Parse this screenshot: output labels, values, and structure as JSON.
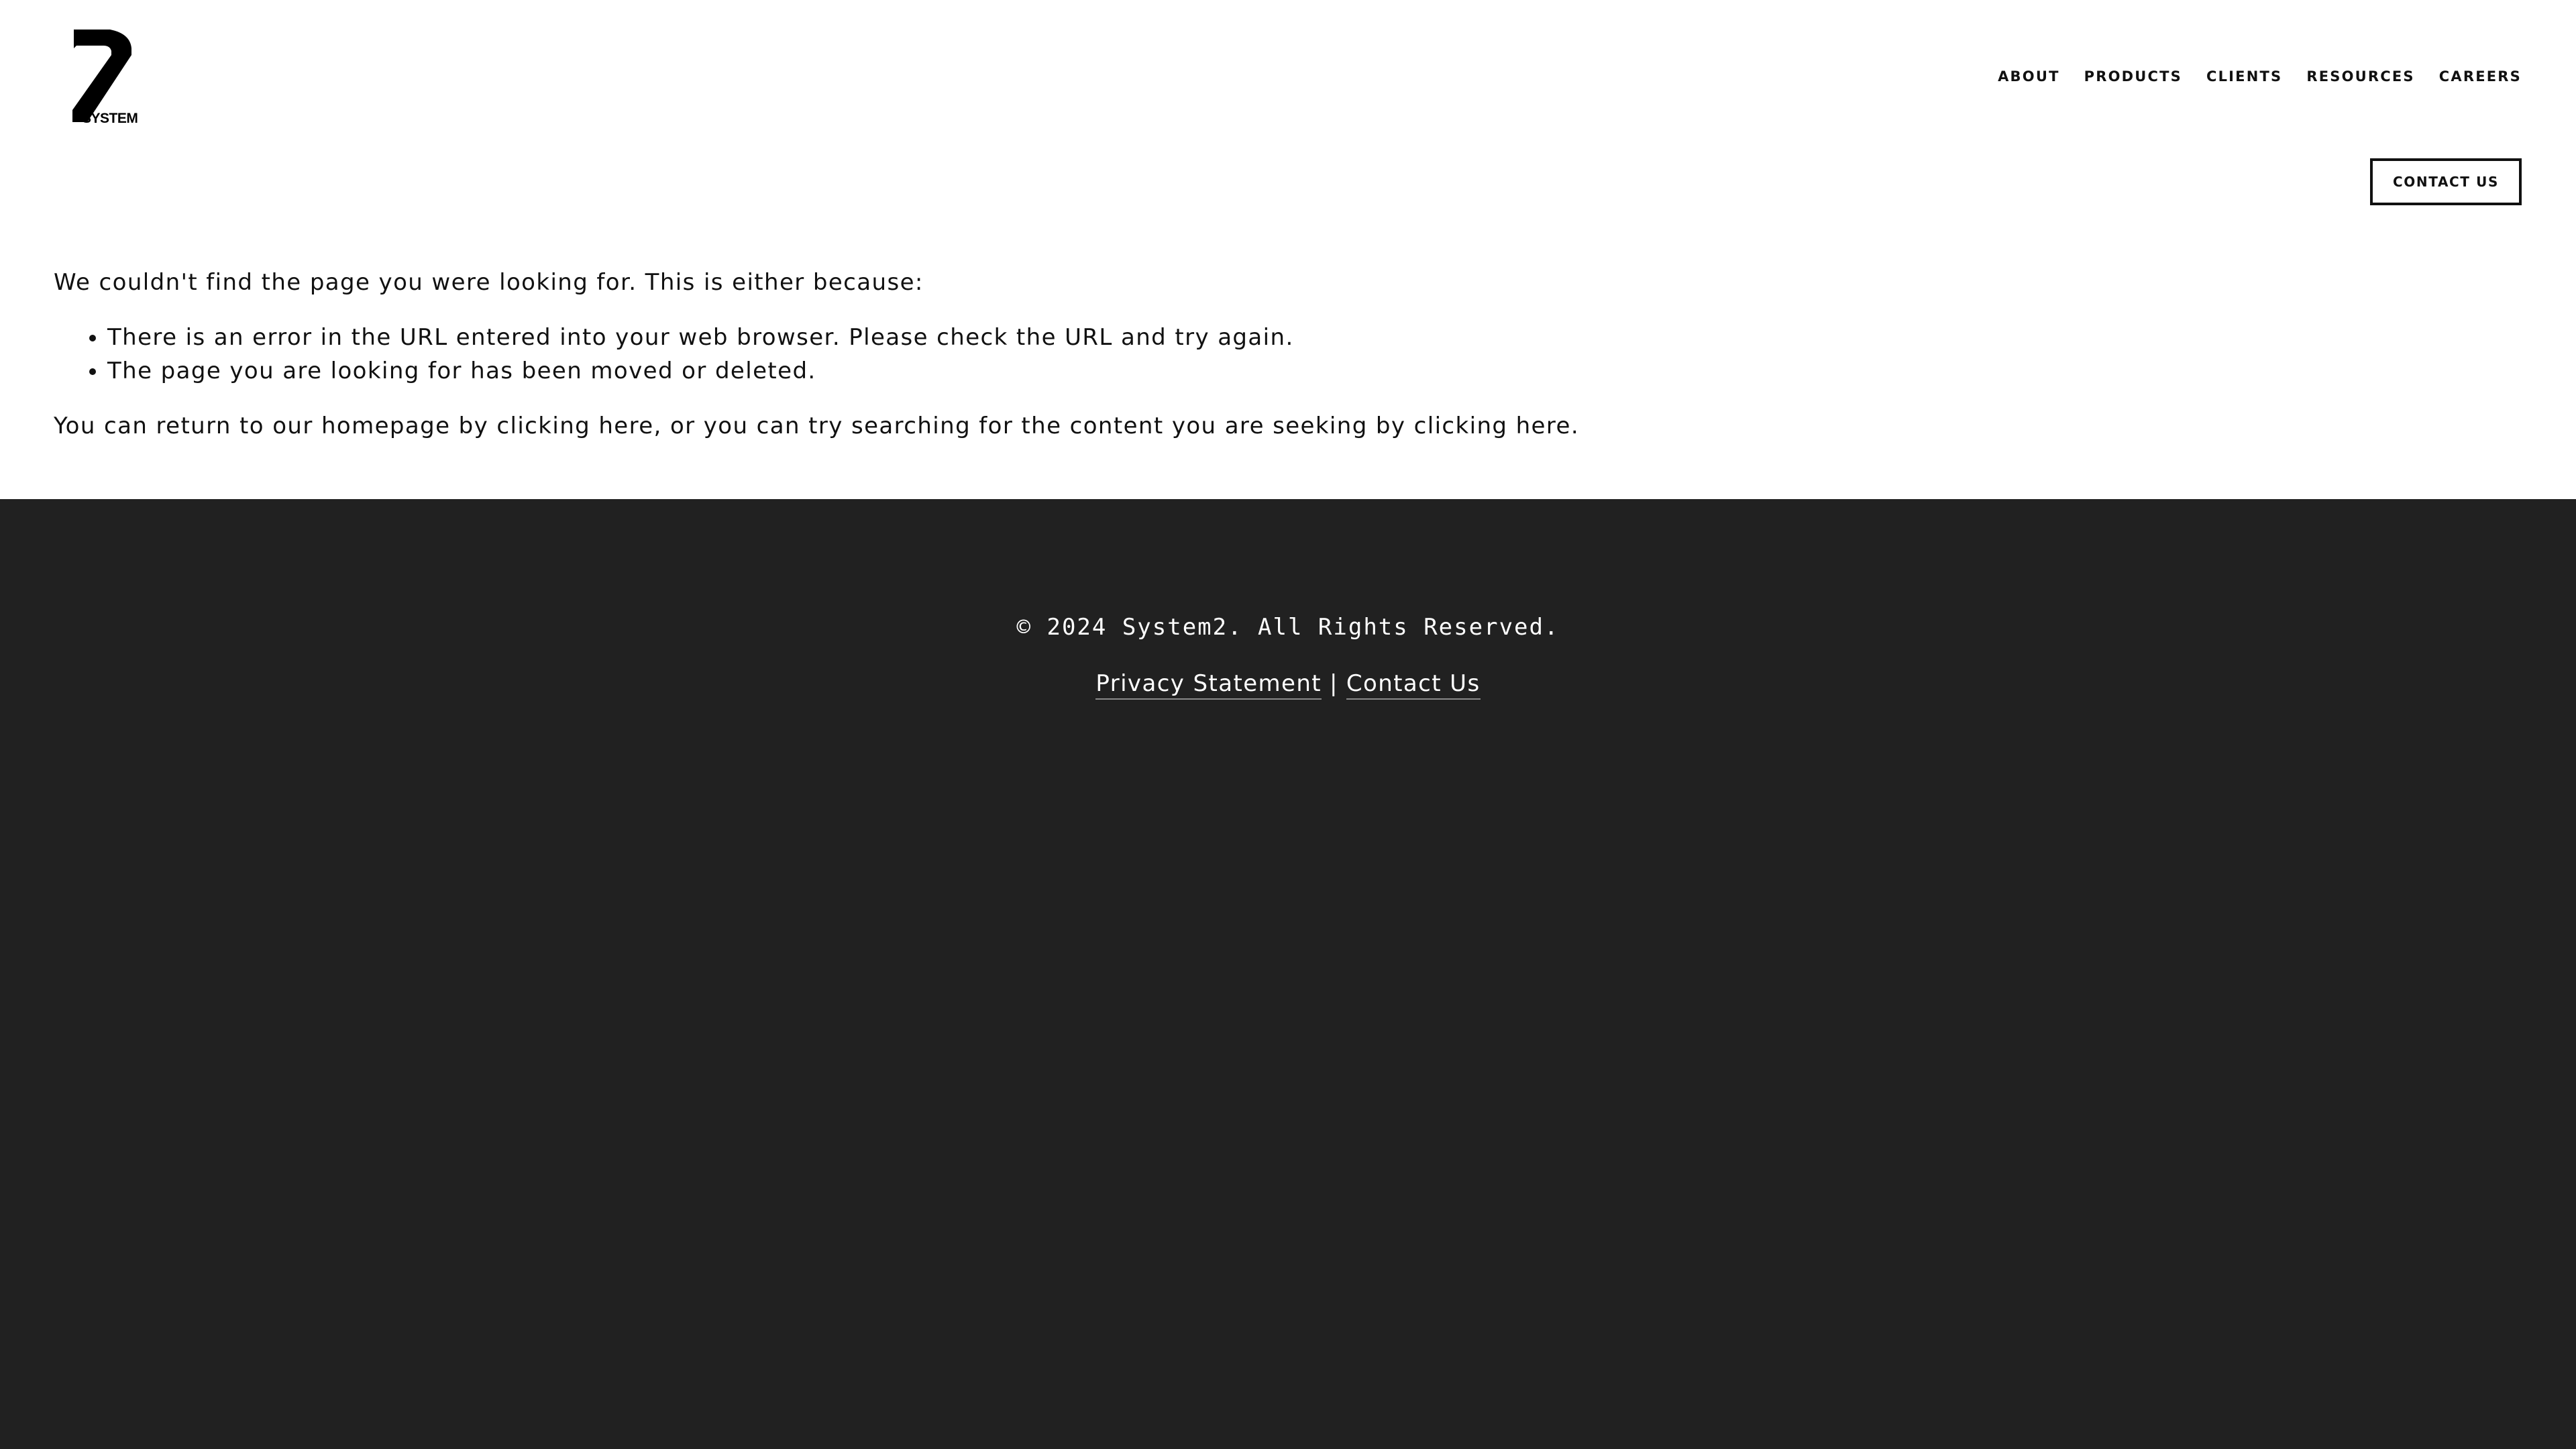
{
  "header": {
    "logo_text": "SYSTEM",
    "nav": [
      {
        "label": "ABOUT"
      },
      {
        "label": "PRODUCTS"
      },
      {
        "label": "CLIENTS"
      },
      {
        "label": "RESOURCES"
      },
      {
        "label": "CAREERS"
      }
    ],
    "contact_button": "CONTACT US"
  },
  "main": {
    "intro": "We couldn't find the page you were looking for. This is either because:",
    "reasons": [
      "There is an error in the URL entered into your web browser. Please check the URL and try again.",
      "The page you are looking for has been moved or deleted."
    ],
    "return_prefix": "You can return to our homepage by ",
    "return_link": "clicking here",
    "return_middle": ", or you can try searching for the content you are seeking by ",
    "search_link": "clicking here",
    "return_suffix": "."
  },
  "footer": {
    "copyright": "© 2024 System2. All Rights Reserved.",
    "privacy_link": "Privacy Statement",
    "separator": "|",
    "contact_link": "Contact Us"
  },
  "colors": {
    "footer_bg": "#212121",
    "text": "#111111",
    "footer_text": "#ffffff"
  },
  "icons": {
    "logo": "system2-slash-logo"
  }
}
